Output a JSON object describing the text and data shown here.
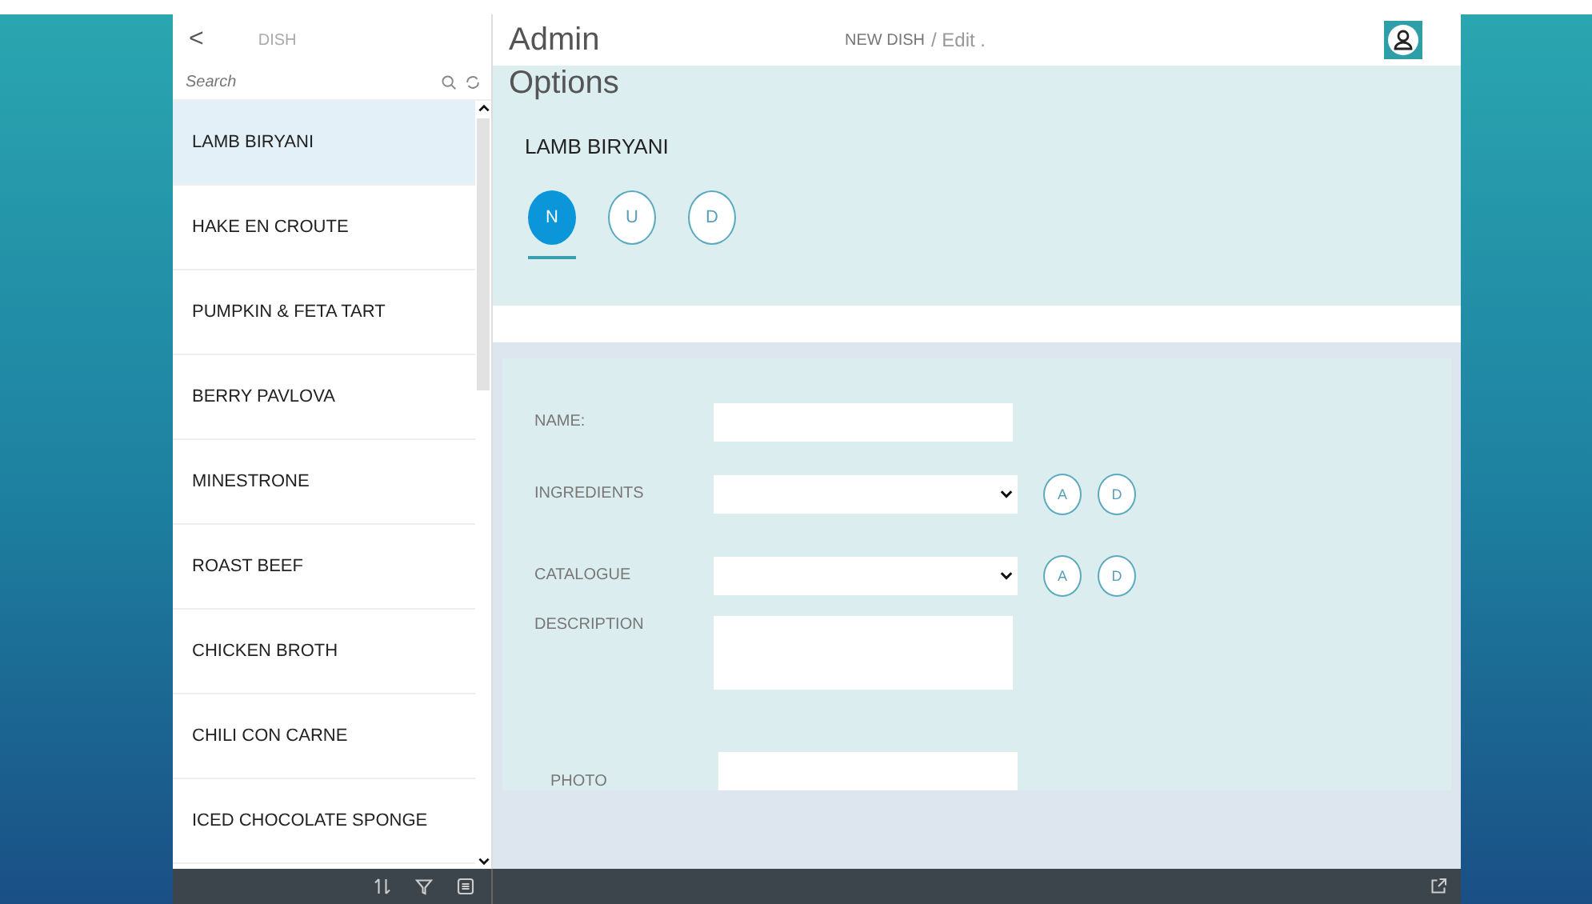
{
  "sidebar": {
    "back": "<",
    "title": "DISH",
    "search": {
      "placeholder": "Search"
    },
    "items": [
      {
        "label": "LAMB BIRYANI",
        "selected": true
      },
      {
        "label": "HAKE EN CROUTE",
        "selected": false
      },
      {
        "label": "PUMPKIN & FETA TART",
        "selected": false
      },
      {
        "label": "BERRY PAVLOVA",
        "selected": false
      },
      {
        "label": "MINESTRONE",
        "selected": false
      },
      {
        "label": "ROAST BEEF",
        "selected": false
      },
      {
        "label": "CHICKEN BROTH",
        "selected": false
      },
      {
        "label": "CHILI CON CARNE",
        "selected": false
      },
      {
        "label": "ICED CHOCOLATE SPONGE",
        "selected": false
      }
    ]
  },
  "header": {
    "title": "Admin",
    "breadcrumb": [
      "NEW DISH",
      "/ Edit ."
    ]
  },
  "options": {
    "title": "Options",
    "dish": "LAMB BIRYANI",
    "tabs": [
      {
        "label": "N",
        "selected": true
      },
      {
        "label": "U",
        "selected": false
      },
      {
        "label": "D",
        "selected": false
      }
    ]
  },
  "form": [
    {
      "kind": "text",
      "label": "NAME:"
    },
    {
      "kind": "select",
      "label": "INGREDIENTS",
      "buttons": [
        "A",
        "D"
      ]
    },
    {
      "kind": "select",
      "label": "CATALOGUE",
      "buttons": [
        "A",
        "D"
      ]
    },
    {
      "kind": "textarea",
      "label": "DESCRIPTION"
    },
    {
      "kind": "text",
      "label": "PHOTO"
    }
  ]
}
